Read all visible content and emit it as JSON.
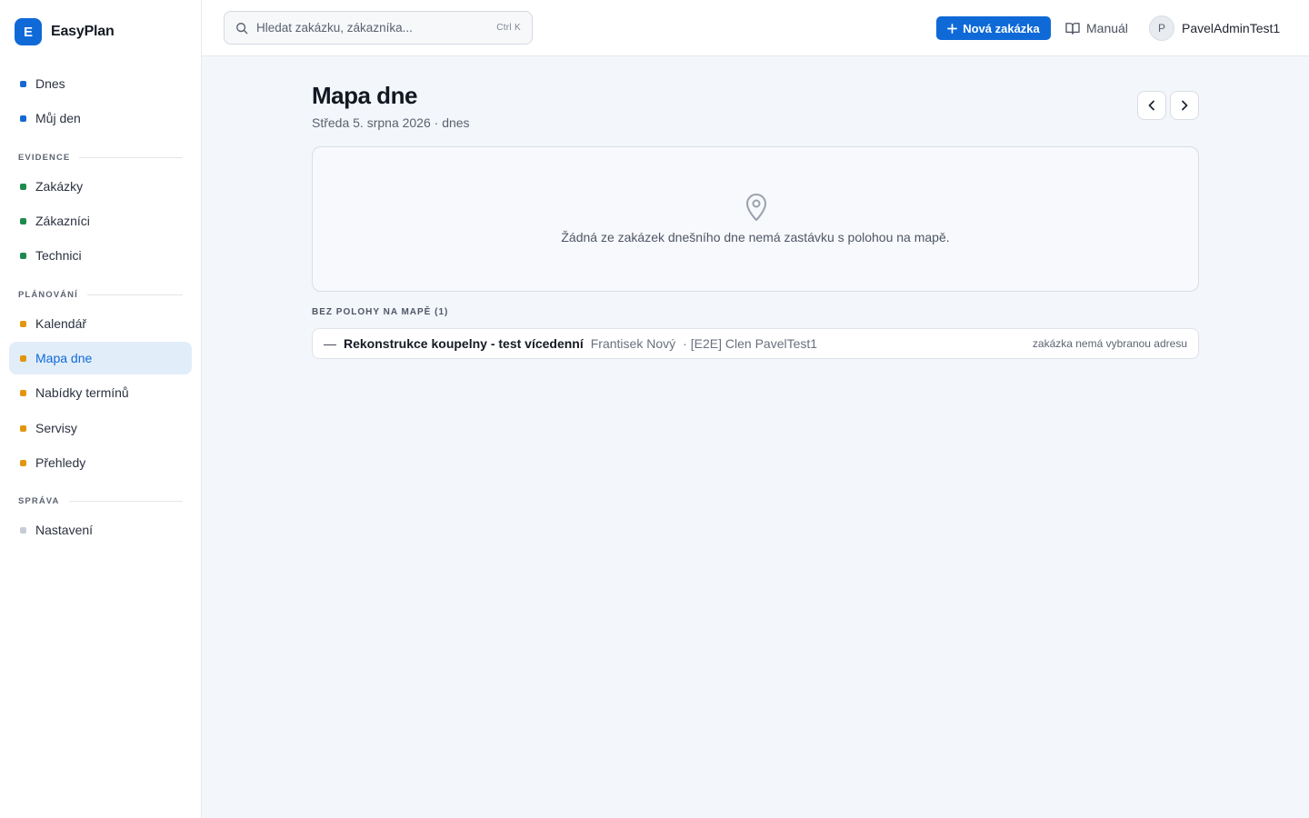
{
  "app": {
    "logo_letter": "E",
    "name": "EasyPlan"
  },
  "sidebar": {
    "items_top": [
      {
        "label": "Dnes",
        "color": "#1668d4"
      },
      {
        "label": "Můj den",
        "color": "#1668d4"
      }
    ],
    "sections": [
      {
        "title": "EVIDENCE",
        "items": [
          {
            "label": "Zakázky",
            "color": "#1d8a4e"
          },
          {
            "label": "Zákazníci",
            "color": "#1d8a4e"
          },
          {
            "label": "Technici",
            "color": "#1d8a4e"
          }
        ]
      },
      {
        "title": "PLÁNOVÁNÍ",
        "items": [
          {
            "label": "Kalendář",
            "color": "#e3960d"
          },
          {
            "label": "Mapa dne",
            "color": "#e3960d",
            "active": true
          },
          {
            "label": "Nabídky termínů",
            "color": "#e3960d"
          },
          {
            "label": "Servisy",
            "color": "#e3960d"
          },
          {
            "label": "Přehledy",
            "color": "#e3960d"
          }
        ]
      },
      {
        "title": "SPRÁVA",
        "items": [
          {
            "label": "Nastavení",
            "color": "#c8ccd4"
          }
        ]
      }
    ]
  },
  "topbar": {
    "search_placeholder": "Hledat zakázku, zákazníka...",
    "search_shortcut": "Ctrl K",
    "new_button": "Nová zakázka",
    "manual": "Manuál",
    "avatar_letter": "P",
    "username": "PavelAdminTest1"
  },
  "main": {
    "title": "Mapa dne",
    "subtitle": "Středa 5. srpna 2026 · dnes",
    "map_empty_message": "Žádná ze zakázek dnešního dne nemá zastávku s polohou na mapě.",
    "no_location_heading": "BEZ POLOHY NA MAPĚ (1)",
    "rows": [
      {
        "dash": "—",
        "job": "Rekonstrukce koupelny - test vícedenní",
        "customer": "Frantisek Nový",
        "separator": "·",
        "technician": "[E2E] Clen PavelTest1",
        "note": "zakázka nemá vybranou adresu"
      }
    ]
  },
  "colors": {
    "accent": "#0f6ad8",
    "evidence": "#1d8a4e",
    "planning": "#e3960d",
    "admin": "#c8ccd4"
  },
  "icons": [
    "search-icon",
    "plus-icon",
    "book-icon",
    "chevron-left-icon",
    "chevron-right-icon",
    "map-pin-icon"
  ]
}
